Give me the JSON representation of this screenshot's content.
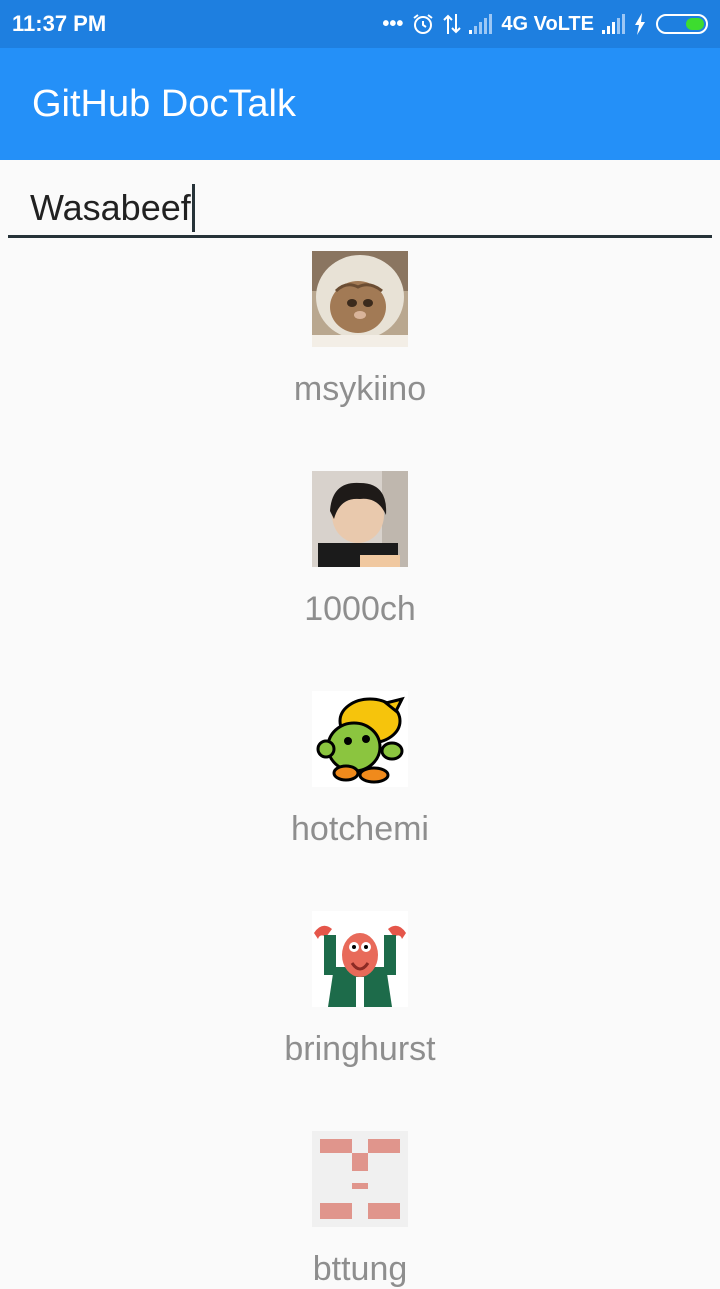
{
  "status_bar": {
    "time": "11:37 PM",
    "network": "4G VoLTE"
  },
  "app_bar": {
    "title": "GitHub DocTalk"
  },
  "search": {
    "value": "Wasabeef"
  },
  "users": [
    {
      "login": "msykiino",
      "avatar": "cat-avatar"
    },
    {
      "login": "1000ch",
      "avatar": "person-avatar"
    },
    {
      "login": "hotchemi",
      "avatar": "wapuu-android-avatar"
    },
    {
      "login": "bringhurst",
      "avatar": "zoidberg-avatar"
    },
    {
      "login": "bttung",
      "avatar": "identicon-avatar"
    }
  ],
  "colors": {
    "status_bar": "#1e7fe0",
    "app_bar": "#2490f8",
    "background": "#fafafa",
    "username_text": "#8e8e8e"
  }
}
